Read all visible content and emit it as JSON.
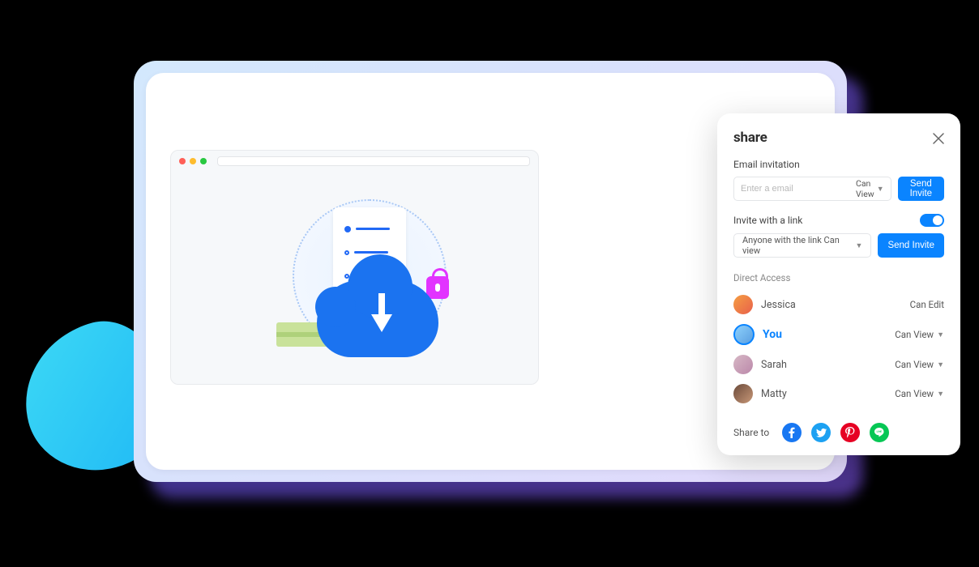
{
  "share": {
    "title": "share",
    "email_label": "Email invitation",
    "email_placeholder": "Enter a email",
    "email_perm": "Can View",
    "send_invite": "Send Invite",
    "link_label": "Invite with a link",
    "link_option": "Anyone with the link Can view",
    "link_send": "Send Invite",
    "direct_access": "Direct Access",
    "people": [
      {
        "name": "Jessica",
        "role": "Can Edit",
        "dropdown": false
      },
      {
        "name": "You",
        "role": "Can View",
        "dropdown": true,
        "is_you": true
      },
      {
        "name": "Sarah",
        "role": "Can View",
        "dropdown": true
      },
      {
        "name": "Matty",
        "role": "Can View",
        "dropdown": true
      }
    ],
    "share_to": "Share to"
  }
}
